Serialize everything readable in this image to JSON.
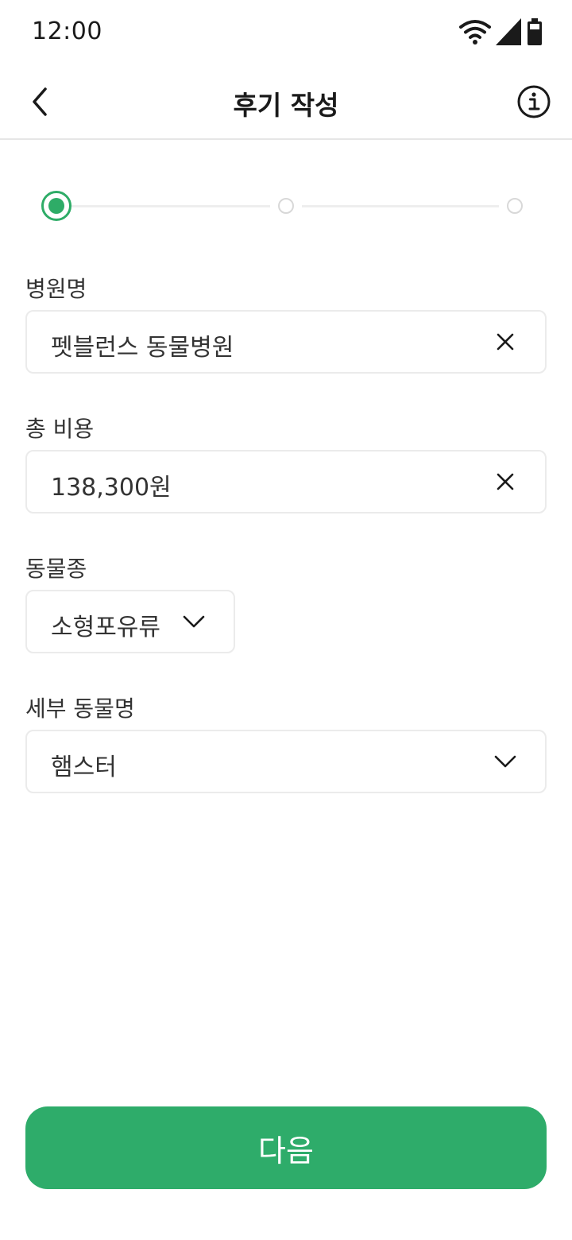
{
  "status_bar": {
    "time": "12:00",
    "icons": [
      "wifi-icon",
      "signal-icon",
      "battery-icon"
    ]
  },
  "header": {
    "title": "후기 작성",
    "back_icon": "chevron-left-icon",
    "info_icon": "info-icon"
  },
  "stepper": {
    "total_steps": 3,
    "current_step": 1
  },
  "form": {
    "hospital": {
      "label": "병원명",
      "value": "펫블런스 동물병원",
      "action_icon": "close-icon"
    },
    "total_cost": {
      "label": "총 비용",
      "value": "138,300원",
      "action_icon": "close-icon"
    },
    "species": {
      "label": "동물종",
      "value": "소형포유류",
      "action_icon": "chevron-down-icon"
    },
    "animal_detail": {
      "label": "세부 동물명",
      "value": "햄스터",
      "action_icon": "chevron-down-icon"
    }
  },
  "footer": {
    "next_label": "다음"
  },
  "colors": {
    "accent": "#2eac6a",
    "border": "#ebebeb",
    "divider": "#e6e6e6"
  }
}
